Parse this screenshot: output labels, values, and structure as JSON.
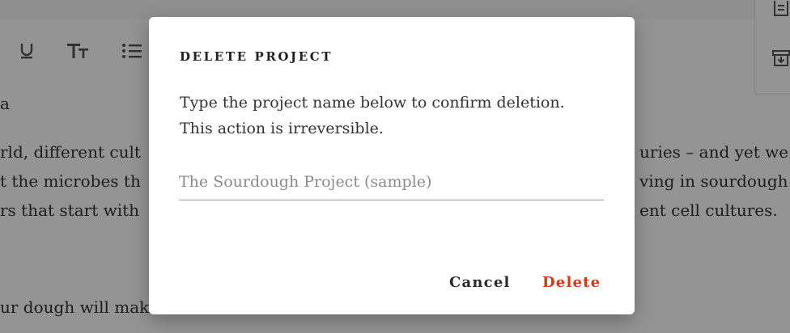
{
  "editor": {
    "lines": [
      "a",
      "rld, different cult",
      "t the microbes th",
      "rs that start with",
      "ur dough will mak"
    ],
    "lines_right": [
      "uries – and yet we",
      "ving in sourdough",
      "ent cell cultures."
    ]
  },
  "dialog": {
    "title": "DELETE PROJECT",
    "message": "Type the project name below to confirm deletion. This action is irreversible.",
    "input_placeholder": "The Sourdough Project (sample)",
    "input_value": "",
    "cancel_label": "Cancel",
    "delete_label": "Delete"
  },
  "colors": {
    "danger": "#d23a17",
    "overlay": "rgba(0,0,0,0.42)"
  }
}
